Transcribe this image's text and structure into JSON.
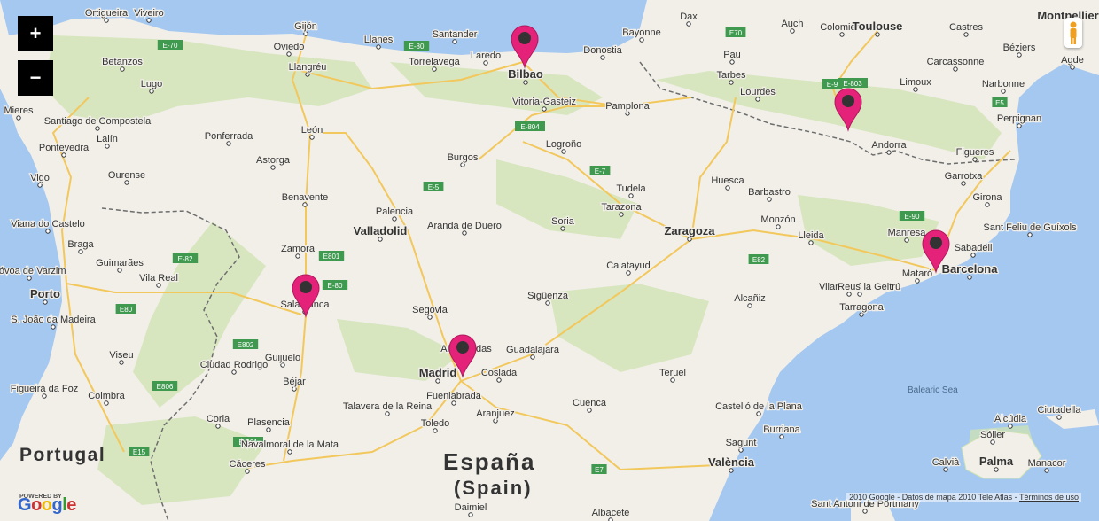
{
  "controls": {
    "zoom_in": "+",
    "zoom_out": "−"
  },
  "map_icons": {
    "pegman": "pegman-icon",
    "marker": "map-marker-icon"
  },
  "colors": {
    "water": "#a5c8f0",
    "land": "#f2efe9",
    "green": "#cfe3b1",
    "marker": "#e5227a",
    "marker_dot": "#333333",
    "road_yellow": "#f2c85c",
    "highway_green": "#3f9a4f",
    "border": "#6d6d6d"
  },
  "countries": [
    {
      "key": "portugal",
      "text": "Portugal"
    },
    {
      "key": "espana",
      "text": "España"
    },
    {
      "key": "spain",
      "text": "(Spain)"
    }
  ],
  "sea_labels": [
    {
      "key": "balearic",
      "text": "Balearic Sea"
    }
  ],
  "cities": [
    {
      "name": "Ortigueira"
    },
    {
      "name": "Viveiro"
    },
    {
      "name": "Gijón"
    },
    {
      "name": "Oviedo"
    },
    {
      "name": "Llanes"
    },
    {
      "name": "Santander"
    },
    {
      "name": "Torrelavega"
    },
    {
      "name": "Laredo"
    },
    {
      "name": "Bilbao"
    },
    {
      "name": "Donostia"
    },
    {
      "name": "Bayonne"
    },
    {
      "name": "Dax"
    },
    {
      "name": "Auch"
    },
    {
      "name": "Colomiers"
    },
    {
      "name": "Toulouse"
    },
    {
      "name": "Castres"
    },
    {
      "name": "Montpellier"
    },
    {
      "name": "Pau"
    },
    {
      "name": "Tarbes"
    },
    {
      "name": "Carcassonne"
    },
    {
      "name": "Béziers"
    },
    {
      "name": "Agde"
    },
    {
      "name": "Lourdes"
    },
    {
      "name": "Limoux"
    },
    {
      "name": "Narbonne"
    },
    {
      "name": "Perpignan"
    },
    {
      "name": "Andorra"
    },
    {
      "name": "Betanzos"
    },
    {
      "name": "Lugo"
    },
    {
      "name": "Mieres"
    },
    {
      "name": "Llangréu"
    },
    {
      "name": "Santiago de Compostela"
    },
    {
      "name": "Lalín"
    },
    {
      "name": "Ponferrada"
    },
    {
      "name": "León"
    },
    {
      "name": "Astorga"
    },
    {
      "name": "Pontevedra"
    },
    {
      "name": "Ourense"
    },
    {
      "name": "Vigo"
    },
    {
      "name": "Vitoria-Gasteiz"
    },
    {
      "name": "Pamplona"
    },
    {
      "name": "Logroño"
    },
    {
      "name": "Burgos"
    },
    {
      "name": "Tudela"
    },
    {
      "name": "Tarazona"
    },
    {
      "name": "Huesca"
    },
    {
      "name": "Barbastro"
    },
    {
      "name": "Monzón"
    },
    {
      "name": "Figueres"
    },
    {
      "name": "Garrotxa"
    },
    {
      "name": "Girona"
    },
    {
      "name": "Sant Feliu de Guíxols"
    },
    {
      "name": "Viana do Castelo"
    },
    {
      "name": "Braga"
    },
    {
      "name": "Guimarães"
    },
    {
      "name": "Póvoa de Varzim"
    },
    {
      "name": "Vila Real"
    },
    {
      "name": "Porto"
    },
    {
      "name": "S. João da Madeira"
    },
    {
      "name": "Benavente"
    },
    {
      "name": "Zamora"
    },
    {
      "name": "Palencia"
    },
    {
      "name": "Valladolid"
    },
    {
      "name": "Aranda de Duero"
    },
    {
      "name": "Soria"
    },
    {
      "name": "Zaragoza"
    },
    {
      "name": "Lleida"
    },
    {
      "name": "Manresa"
    },
    {
      "name": "Sabadell"
    },
    {
      "name": "Mataró"
    },
    {
      "name": "Vilanova i la Geltrú"
    },
    {
      "name": "Barcelona"
    },
    {
      "name": "Reus"
    },
    {
      "name": "Tarragona"
    },
    {
      "name": "Calatayud"
    },
    {
      "name": "Alcañiz"
    },
    {
      "name": "Salamanca"
    },
    {
      "name": "Segovia"
    },
    {
      "name": "Sigüenza"
    },
    {
      "name": "Alcobendas"
    },
    {
      "name": "Guadalajara"
    },
    {
      "name": "Madrid"
    },
    {
      "name": "Coslada"
    },
    {
      "name": "Fuenlabrada"
    },
    {
      "name": "Aranjuez"
    },
    {
      "name": "Toledo"
    },
    {
      "name": "Cuenca"
    },
    {
      "name": "Teruel"
    },
    {
      "name": "Castelló de la Plana"
    },
    {
      "name": "Burriana"
    },
    {
      "name": "Sagunt"
    },
    {
      "name": "València"
    },
    {
      "name": "Viseu"
    },
    {
      "name": "Ciudad Rodrigo"
    },
    {
      "name": "Guijuelo"
    },
    {
      "name": "Béjar"
    },
    {
      "name": "Figueira da Foz"
    },
    {
      "name": "Coimbra"
    },
    {
      "name": "Talavera de la Reina"
    },
    {
      "name": "Plasencia"
    },
    {
      "name": "Navalmoral de la Mata"
    },
    {
      "name": "Coria"
    },
    {
      "name": "Cáceres"
    },
    {
      "name": "Ciutadella"
    },
    {
      "name": "Sóller"
    },
    {
      "name": "Alcúdia"
    },
    {
      "name": "Palma"
    },
    {
      "name": "Manacor"
    },
    {
      "name": "Calvià"
    },
    {
      "name": "Sant Antoni de Portmany"
    },
    {
      "name": "Daimiel"
    },
    {
      "name": "Albacete"
    }
  ],
  "roads": [
    "E-70",
    "E-80",
    "E-5",
    "E-804",
    "E-7",
    "E-9",
    "E-90",
    "E82",
    "E-82",
    "E801",
    "E-80",
    "E80",
    "E802",
    "E-803",
    "E806",
    "E-901",
    "E15",
    "E7",
    "E5",
    "E70"
  ],
  "markers": [
    {
      "name": "Bilbao"
    },
    {
      "name": "Andorra region"
    },
    {
      "name": "Salamanca"
    },
    {
      "name": "Madrid"
    },
    {
      "name": "Barcelona"
    }
  ],
  "footer": {
    "attribution": "2010 Google - Datos de mapa 2010 Tele Atlas -",
    "terms": "Términos de uso",
    "powered_by": "POWERED BY",
    "logo": [
      "G",
      "o",
      "o",
      "g",
      "l",
      "e"
    ]
  }
}
